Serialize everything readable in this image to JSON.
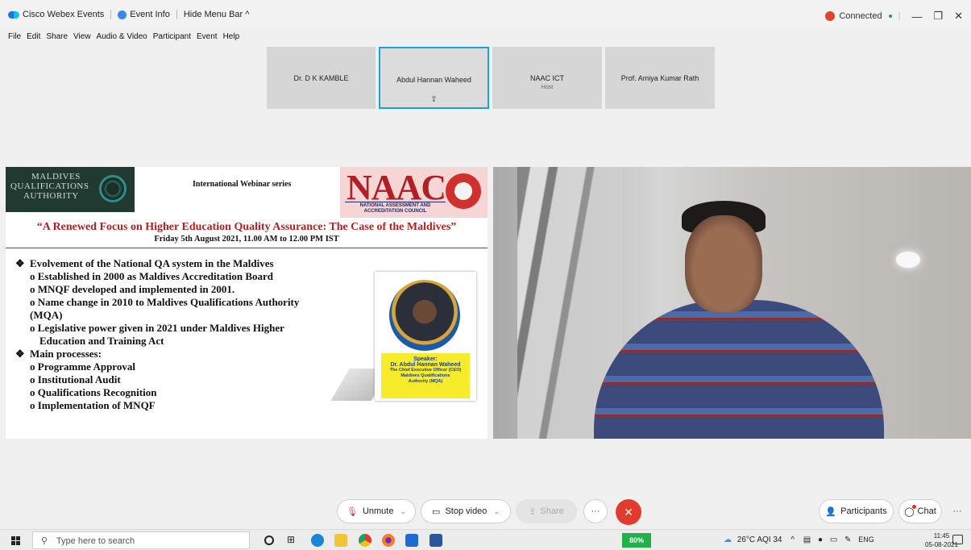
{
  "titlebar": {
    "app_name": "Cisco Webex Events",
    "event_info": "Event Info",
    "hide_menu": "Hide Menu Bar ^",
    "status": "Connected",
    "minimize": "—",
    "restore": "❐",
    "close": "✕"
  },
  "menu": {
    "items": [
      "File",
      "Edit",
      "Share",
      "View",
      "Audio & Video",
      "Participant",
      "Event",
      "Help"
    ]
  },
  "participants": [
    {
      "name": "Dr. D K KAMBLE",
      "sub": ""
    },
    {
      "name": "Abdul Hannan Waheed",
      "sub": ""
    },
    {
      "name": "NAAC ICT",
      "sub": "Host"
    },
    {
      "name": "Prof.  Amiya Kumar Rath",
      "sub": ""
    }
  ],
  "slide": {
    "mqa_line1": "MALDIVES",
    "mqa_line2": "QUALIFICATIONS",
    "mqa_line3": "AUTHORITY",
    "series": "International Webinar series",
    "naac": "NAAC",
    "naac_sub": "NATIONAL ASSESSMENT AND ACCREDITATION COUNCIL",
    "title": "“A Renewed Focus on Higher Education Quality Assurance: The Case of the Maldives”",
    "date": "Friday 5th August 2021, 11.00 AM to 12.00 PM IST",
    "bullet1": "Evolvement of the National QA system in the Maldives",
    "sub1": "o Established in 2000 as Maldives Accreditation Board",
    "sub2": "o MNQF developed and implemented in 2001.",
    "sub3": "o Name change in 2010 to Maldives Qualifications Authority",
    "sub3b": "(MQA)",
    "sub4": "o Legislative power given in 2021 under Maldives Higher",
    "sub4b": "Education and Training Act",
    "bullet2": "Main processes:",
    "p1": "o Programme Approval",
    "p2": "o Institutional Audit",
    "p3": "o Qualifications Recognition",
    "p4": "o Implementation of MNQF",
    "speaker_head": "Speaker:",
    "speaker_name": "Dr. Abdul Hannan Waheed",
    "speaker_role": "The Chief Executive Officer (CEO)",
    "speaker_org": "Maldives Qualifications Authority (MQA)"
  },
  "controls": {
    "unmute": "Unmute",
    "stop_video": "Stop video",
    "share": "Share",
    "more": "···",
    "participants": "Participants",
    "chat": "Chat",
    "more_right": "···"
  },
  "taskbar": {
    "search_placeholder": "Type here to search",
    "battery": "80%",
    "weather": "26°C  AQI 34",
    "lang": "ENG",
    "time": "11:45",
    "date": "05-08-2021"
  }
}
